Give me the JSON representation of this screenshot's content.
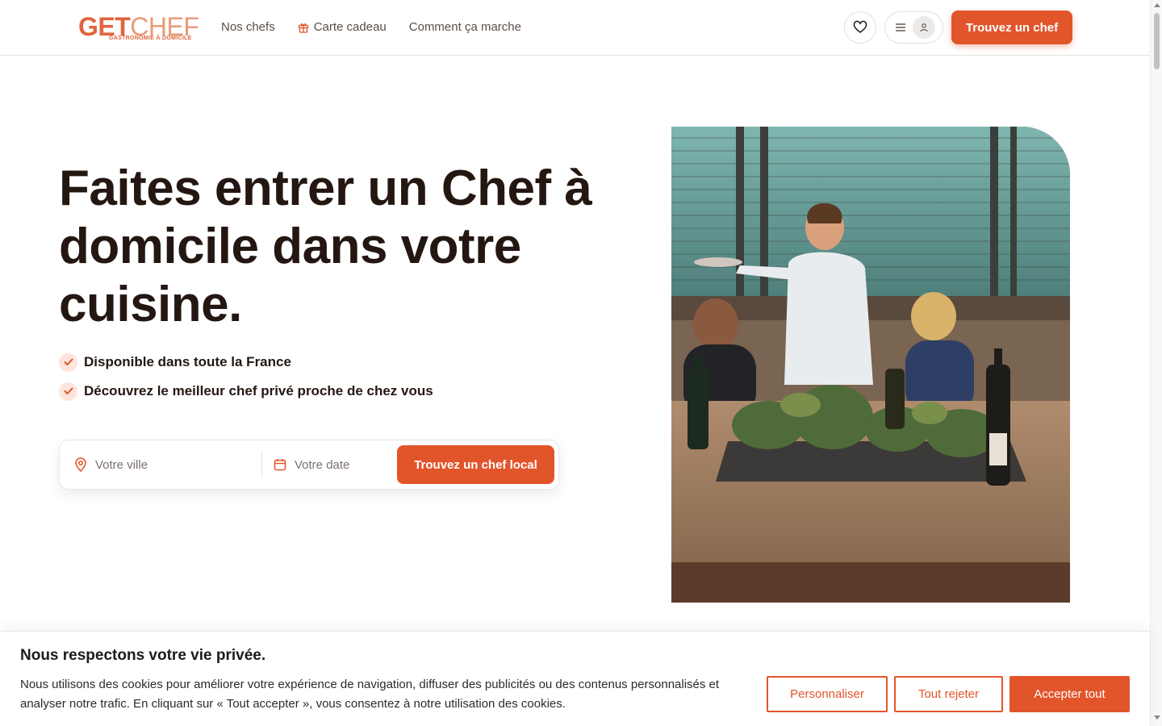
{
  "header": {
    "logo": {
      "mark": "G",
      "word_a": "ET",
      "word_b": "CHEF",
      "tagline": "GASTRONOMIE À DOMICILE"
    },
    "nav": [
      {
        "label": "Nos chefs",
        "icon": null
      },
      {
        "label": "Carte cadeau",
        "icon": "gift-icon"
      },
      {
        "label": "Comment ça marche",
        "icon": null
      }
    ],
    "favorites_icon": "heart-icon",
    "menu_icon": "hamburger-icon",
    "user_icon": "user-icon",
    "cta_label": "Trouvez un chef"
  },
  "hero": {
    "title": "Faites entrer un Chef à domicile dans votre cuisine.",
    "bullets": [
      "Disponible dans toute la France",
      "Découvrez le meilleur chef privé proche de chez vous"
    ],
    "search": {
      "city_placeholder": "Votre ville",
      "city_icon": "map-pin-icon",
      "date_placeholder": "Votre date",
      "date_icon": "calendar-icon",
      "button_label": "Trouvez un chef local"
    }
  },
  "cookie_banner": {
    "title": "Nous respectons votre vie privée.",
    "text": "Nous utilisons des cookies pour améliorer votre expérience de navigation, diffuser des publicités ou des contenus personnalisés et analyser notre trafic. En cliquant sur « Tout accepter », vous consentez à notre utilisation des cookies.",
    "customize_label": "Personnaliser",
    "reject_label": "Tout rejeter",
    "accept_label": "Accepter tout"
  },
  "colors": {
    "brand": "#e2552b",
    "text": "#241711",
    "check_bg": "#fde5dc"
  }
}
